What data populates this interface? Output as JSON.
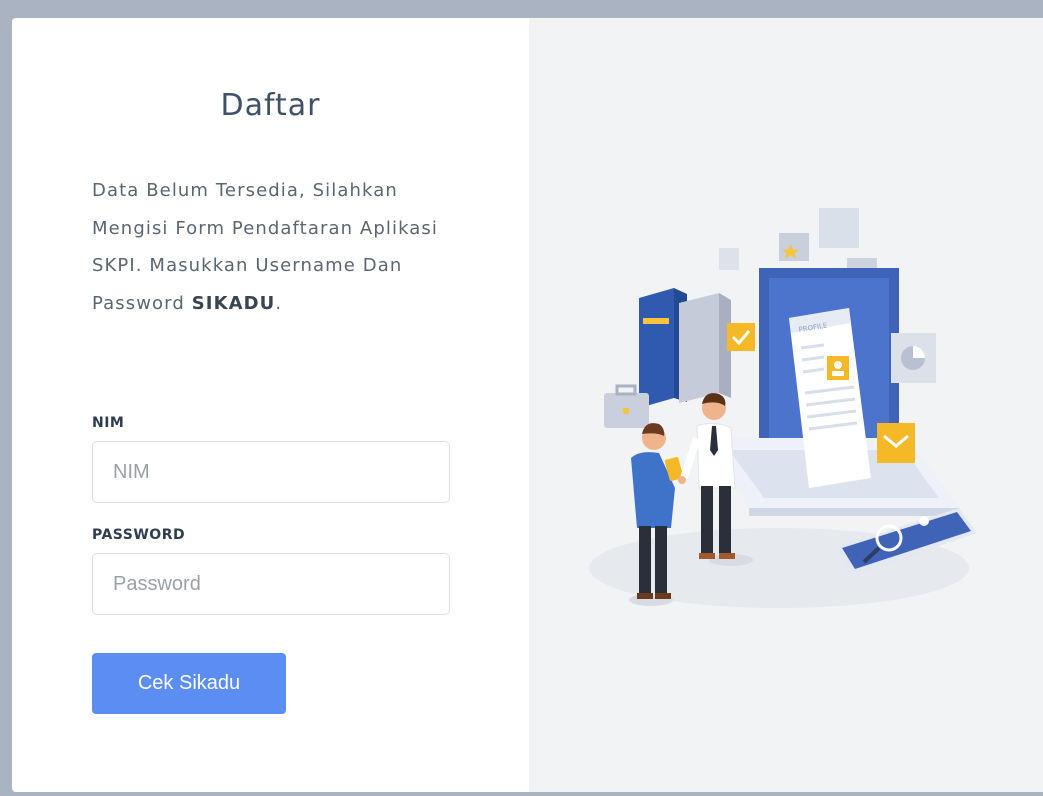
{
  "form": {
    "title": "Daftar",
    "description_text": "Data Belum Tersedia, Silahkan Mengisi Form Pendaftaran Aplikasi SKPI. Masukkan Username Dan Password ",
    "description_bold": "SIKADU",
    "description_end": ".",
    "nim_label": "NIM",
    "nim_placeholder": "NIM",
    "nim_value": "",
    "password_label": "PASSWORD",
    "password_placeholder": "Password",
    "password_value": "",
    "submit_label": "Cek Sikadu"
  },
  "illustration": {
    "icon": "profile-registration-illustration",
    "doc_label": "PROFILE"
  },
  "colors": {
    "accent": "#5b8ef0",
    "title": "#3e5166",
    "right_panel_bg": "#f1f3f4",
    "page_bg": "#a9b3c2"
  }
}
